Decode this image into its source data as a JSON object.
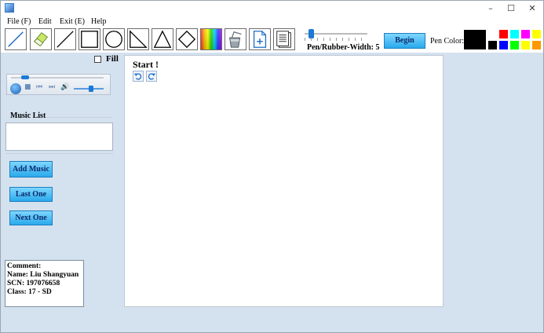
{
  "menu": {
    "file": "File (F)",
    "edit": "Edit",
    "exit": "Exit (E)",
    "help": "Help"
  },
  "window_controls": {
    "minimize": "–",
    "maximize": "☐",
    "close": "✕"
  },
  "tools": [
    {
      "name": "pencil-tool",
      "icon": "pencil-icon"
    },
    {
      "name": "rubber-tool",
      "icon": "eraser-icon"
    },
    {
      "name": "line-tool",
      "icon": "line-icon"
    },
    {
      "name": "rectangle-tool",
      "icon": "rectangle-icon"
    },
    {
      "name": "ellipse-tool",
      "icon": "circle-icon"
    },
    {
      "name": "right-triangle-tool",
      "icon": "right-triangle-icon"
    },
    {
      "name": "triangle-tool",
      "icon": "triangle-icon"
    },
    {
      "name": "diamond-tool",
      "icon": "diamond-icon"
    },
    {
      "name": "color-palette-tool",
      "icon": "rainbow-icon"
    },
    {
      "name": "fill-bucket-tool",
      "icon": "paint-bucket-icon"
    },
    {
      "name": "new-file-tool",
      "icon": "new-file-icon"
    },
    {
      "name": "open-file-tool",
      "icon": "document-icon"
    }
  ],
  "pen_width": {
    "label": "Pen/Rubber-Width: 5",
    "value": 5
  },
  "begin_button": "Begin",
  "pen_color": {
    "label": "Pen Color:",
    "current": "#000000",
    "swatches": [
      "#ffffff",
      "#ff0000",
      "#00ffff",
      "#ff00ff",
      "#ffff00",
      "#000000",
      "#0000ff",
      "#00ff00",
      "#ffff00",
      "#ff9900"
    ]
  },
  "fill": {
    "label": "Fill",
    "checked": false
  },
  "media_player": {
    "icons": [
      "play-icon",
      "stop-icon",
      "previous-icon",
      "next-icon",
      "volume-icon"
    ]
  },
  "music_list": {
    "label": "Music List",
    "items": []
  },
  "buttons": {
    "add_music": "Add Music",
    "last_one": "Last One",
    "next_one": "Next One"
  },
  "comment": {
    "line1": "Comment:",
    "line2": "Name: Liu Shangyuan",
    "line3": "SCN: 197076658",
    "line4": "Class: 17 - SD"
  },
  "canvas": {
    "title": "Start !"
  }
}
